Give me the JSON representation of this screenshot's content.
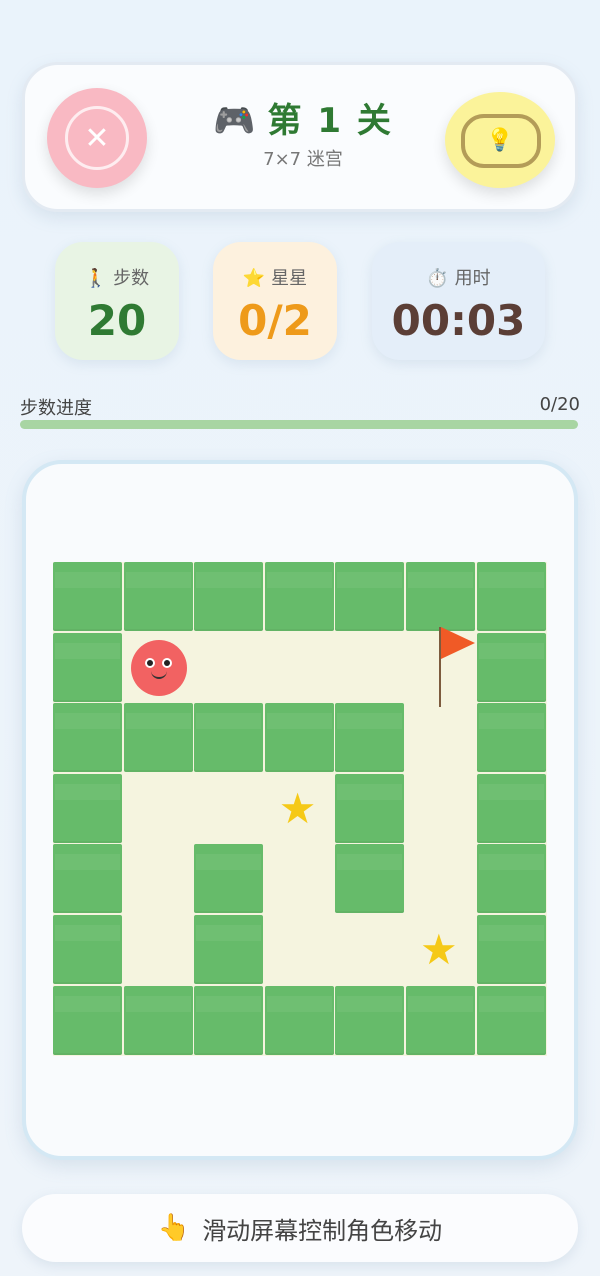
{
  "header": {
    "title": "第 1 关",
    "subtitle": "7×7 迷宫",
    "close_icon": "close-icon",
    "hint_icon": "lightbulb-icon",
    "gamepad_icon": "gamepad-icon",
    "colors": {
      "close_bg": "#f9b9c3",
      "hint_bg": "#fbf39a",
      "title": "#2f7a33"
    }
  },
  "stats": {
    "steps": {
      "icon": "walking-icon",
      "label": "步数",
      "value": "20",
      "color": "#2f7a33"
    },
    "stars": {
      "icon": "star-icon",
      "label": "星星",
      "value": "0/2",
      "color": "#ee9a1a"
    },
    "time": {
      "icon": "stopwatch-icon",
      "label": "用时",
      "value": "00:03",
      "color": "#5b3e36"
    }
  },
  "progress": {
    "label": "步数进度",
    "count": "0/20",
    "fraction": 0
  },
  "maze": {
    "size": 7,
    "grid": [
      "#######",
      "#P...F#",
      "#####.#",
      "#..*#.#",
      "#.#.#.#",
      "#.#..*#",
      "#######"
    ],
    "wall_color": "#66bb6a",
    "floor_color": "#f5f4df",
    "player_color": "#f26262",
    "star_color": "#f5c917",
    "flag_color": "#f05a26"
  },
  "footer": {
    "icon": "pointing-hand-icon",
    "text": "滑动屏幕控制角色移动"
  }
}
